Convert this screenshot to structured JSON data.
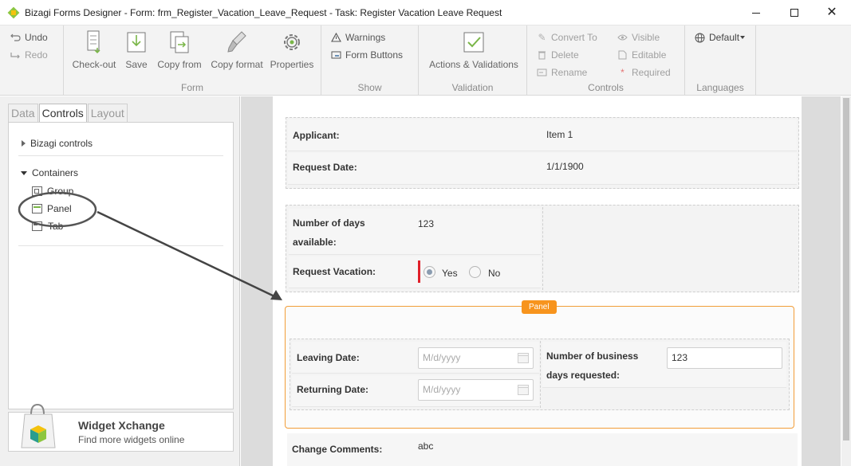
{
  "window": {
    "title": "Bizagi Forms Designer  - Form: frm_Register_Vacation_Leave_Request - Task:  Register Vacation Leave Request",
    "close_glyph": "✕"
  },
  "ribbon": {
    "undo": "Undo",
    "redo": "Redo",
    "form_group": {
      "label": "Form",
      "buttons": [
        "Check-out",
        "Save",
        "Copy from",
        "Copy format",
        "Properties"
      ]
    },
    "show_group": {
      "label": "Show",
      "warnings": "Warnings",
      "form_buttons": "Form Buttons"
    },
    "validation_group": {
      "label": "Validation",
      "actions": "Actions & Validations"
    },
    "controls_group": {
      "label": "Controls",
      "convert_to": "Convert To",
      "delete": "Delete",
      "rename": "Rename",
      "visible": "Visible",
      "editable": "Editable",
      "required": "Required"
    },
    "languages_group": {
      "label": "Languages",
      "default": "Default"
    }
  },
  "left_panel": {
    "tabs": [
      "Data",
      "Controls",
      "Layout"
    ],
    "active_tab": "Controls",
    "tree": {
      "bizagi_controls": "Bizagi controls",
      "containers": "Containers",
      "items": [
        "Group",
        "Panel",
        "Tab"
      ]
    },
    "widget": {
      "title": "Widget Xchange",
      "subtitle": "Find more widgets online"
    }
  },
  "form": {
    "applicant_label": "Applicant:",
    "applicant_value": "Item 1",
    "request_date_label": "Request Date:",
    "request_date_value": "1/1/1900",
    "days_available_label_1": "Number of days",
    "days_available_label_2": "available:",
    "days_available_value": "123",
    "request_vacation_label": "Request Vacation:",
    "request_vacation_options": [
      "Yes",
      "No"
    ],
    "request_vacation_selected": "Yes",
    "panel_tag": "Panel",
    "leaving_date_label": "Leaving Date:",
    "leaving_date_placeholder": "M/d/yyyy",
    "returning_date_label": "Returning Date:",
    "returning_date_placeholder": "M/d/yyyy",
    "business_days_label_1": "Number of business",
    "business_days_label_2": "days requested:",
    "business_days_value": "123",
    "change_comments_label": "Change Comments:",
    "change_comments_value": "abc"
  },
  "colors": {
    "panel_border": "#f29d38",
    "panel_tag_bg": "#f7941d",
    "required_mark": "#e0202a",
    "bizagi_green": "#8dc63f"
  }
}
